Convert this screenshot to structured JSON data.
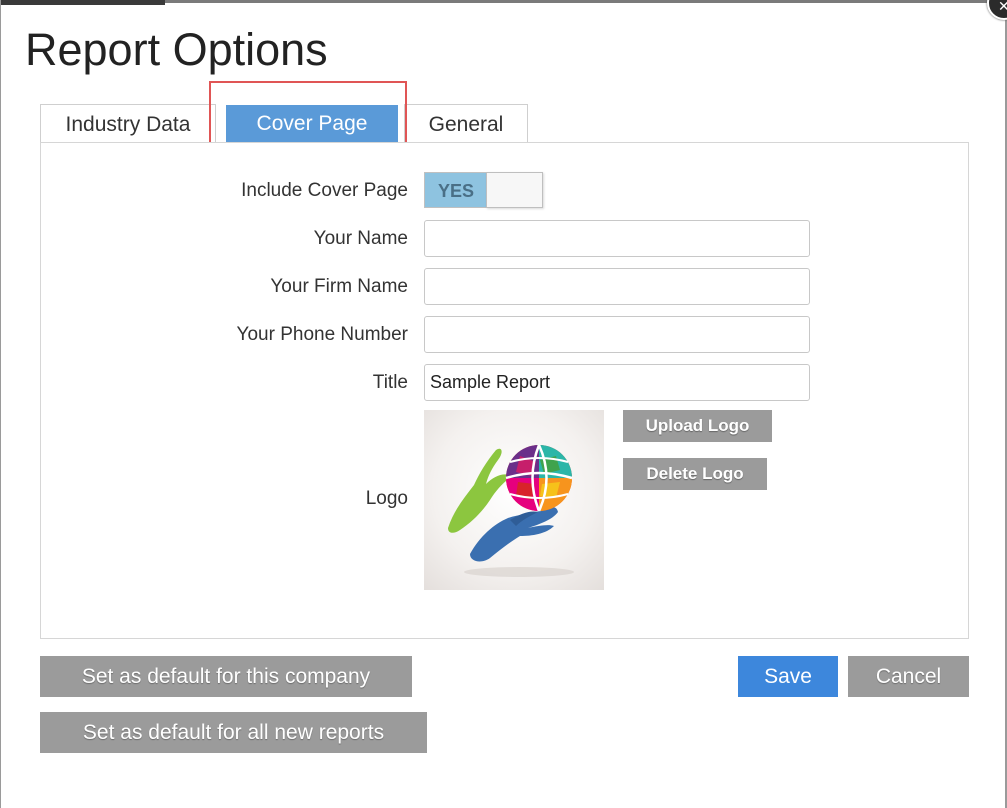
{
  "dialog": {
    "title": "Report Options"
  },
  "tabs": [
    {
      "label": "Industry Data",
      "active": false
    },
    {
      "label": "Cover Page",
      "active": true
    },
    {
      "label": "General",
      "active": false
    }
  ],
  "cover_page": {
    "include_cover_label": "Include Cover Page",
    "include_cover_value": "YES",
    "name_label": "Your Name",
    "name_value": "",
    "firm_label": "Your Firm Name",
    "firm_value": "",
    "phone_label": "Your Phone Number",
    "phone_value": "",
    "title_label": "Title",
    "title_value": "Sample Report",
    "logo_label": "Logo",
    "upload_logo": "Upload Logo",
    "delete_logo": "Delete Logo"
  },
  "footer": {
    "default_company": "Set as default for this company",
    "default_all": "Set as default for all new reports",
    "save": "Save",
    "cancel": "Cancel"
  },
  "colors": {
    "active_tab": "#5a9ad8",
    "primary_button": "#3d87dc",
    "secondary_button": "#9b9b9b",
    "toggle_on": "#8ec3e0",
    "highlight": "#e05555"
  }
}
